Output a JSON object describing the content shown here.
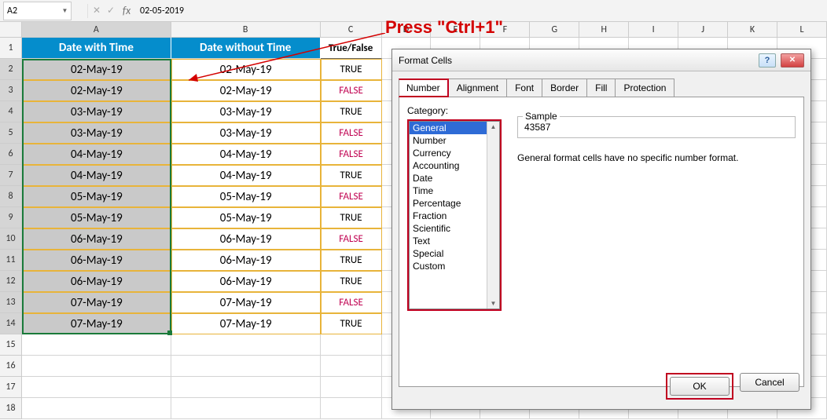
{
  "formula_bar": {
    "name_box": "A2",
    "formula": "02-05-2019"
  },
  "columns": [
    "A",
    "B",
    "C",
    "D",
    "E",
    "F",
    "G",
    "H",
    "I",
    "J",
    "K",
    "L"
  ],
  "headers": {
    "A": "Date with Time",
    "B": "Date without Time",
    "C": "True/False"
  },
  "rows": [
    {
      "n": 2,
      "a": "02-May-19",
      "b": "02-May-19",
      "c": "TRUE",
      "tf": true
    },
    {
      "n": 3,
      "a": "02-May-19",
      "b": "02-May-19",
      "c": "FALSE",
      "tf": false
    },
    {
      "n": 4,
      "a": "03-May-19",
      "b": "03-May-19",
      "c": "TRUE",
      "tf": true
    },
    {
      "n": 5,
      "a": "03-May-19",
      "b": "03-May-19",
      "c": "FALSE",
      "tf": false
    },
    {
      "n": 6,
      "a": "04-May-19",
      "b": "04-May-19",
      "c": "FALSE",
      "tf": false
    },
    {
      "n": 7,
      "a": "04-May-19",
      "b": "04-May-19",
      "c": "TRUE",
      "tf": true
    },
    {
      "n": 8,
      "a": "05-May-19",
      "b": "05-May-19",
      "c": "FALSE",
      "tf": false
    },
    {
      "n": 9,
      "a": "05-May-19",
      "b": "05-May-19",
      "c": "TRUE",
      "tf": true
    },
    {
      "n": 10,
      "a": "06-May-19",
      "b": "06-May-19",
      "c": "FALSE",
      "tf": false
    },
    {
      "n": 11,
      "a": "06-May-19",
      "b": "06-May-19",
      "c": "TRUE",
      "tf": true
    },
    {
      "n": 12,
      "a": "06-May-19",
      "b": "06-May-19",
      "c": "TRUE",
      "tf": true
    },
    {
      "n": 13,
      "a": "07-May-19",
      "b": "07-May-19",
      "c": "FALSE",
      "tf": false
    },
    {
      "n": 14,
      "a": "07-May-19",
      "b": "07-May-19",
      "c": "TRUE",
      "tf": true
    }
  ],
  "empty_rows": [
    15,
    16,
    17,
    18
  ],
  "annotation": "Press \"Ctrl+1\"",
  "dialog": {
    "title": "Format Cells",
    "tabs": [
      "Number",
      "Alignment",
      "Font",
      "Border",
      "Fill",
      "Protection"
    ],
    "active_tab": "Number",
    "category_label": "Category:",
    "categories": [
      "General",
      "Number",
      "Currency",
      "Accounting",
      "Date",
      "Time",
      "Percentage",
      "Fraction",
      "Scientific",
      "Text",
      "Special",
      "Custom"
    ],
    "selected_category": "General",
    "sample_label": "Sample",
    "sample_value": "43587",
    "description": "General format cells have no specific number format.",
    "ok": "OK",
    "cancel": "Cancel",
    "help": "?",
    "close": "✕"
  }
}
